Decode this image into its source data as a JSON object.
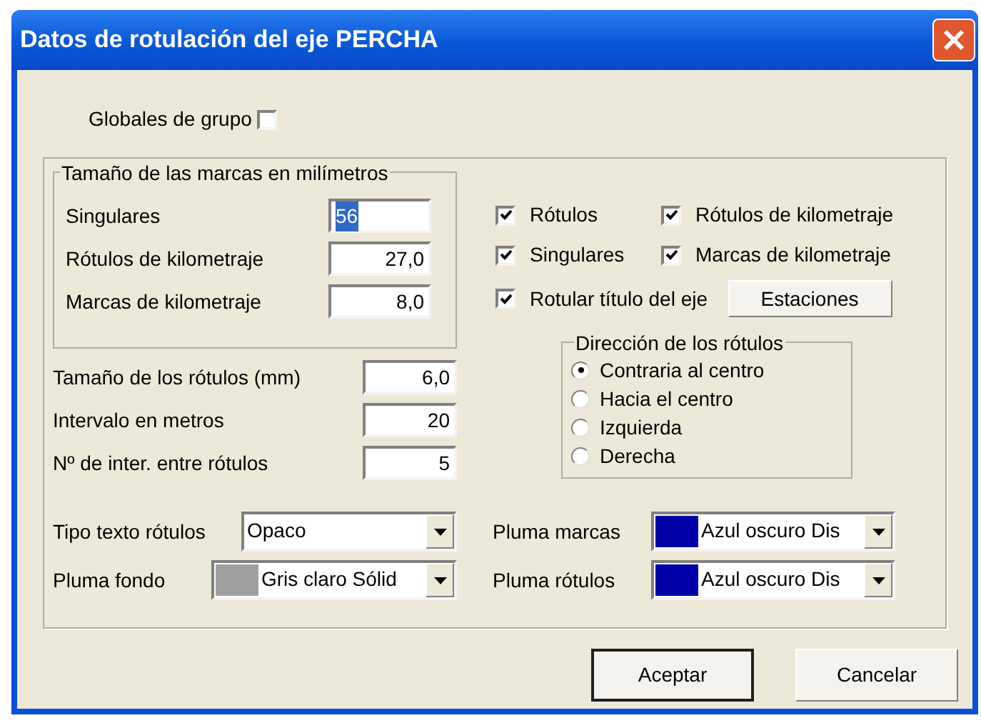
{
  "window": {
    "title": "Datos de rotulación del eje PERCHA"
  },
  "global_group": {
    "label": "Globales de grupo",
    "checked": false
  },
  "sizes_group": {
    "title": "Tamaño de las marcas en milímetros",
    "fields": [
      {
        "label": "Singulares",
        "value": "56",
        "selected": true
      },
      {
        "label": "Rótulos de kilometraje",
        "value": "27,0",
        "selected": false
      },
      {
        "label": "Marcas de kilometraje",
        "value": "8,0",
        "selected": false
      }
    ]
  },
  "fields": [
    {
      "label": "Tamaño de los rótulos (mm)",
      "value": "6,0"
    },
    {
      "label": "Intervalo en metros",
      "value": "20"
    },
    {
      "label": "Nº de inter. entre rótulos",
      "value": "5"
    }
  ],
  "checkboxes": [
    {
      "label": "Rótulos",
      "checked": true
    },
    {
      "label": "Rótulos de kilometraje",
      "checked": true
    },
    {
      "label": "Singulares",
      "checked": true
    },
    {
      "label": "Marcas de kilometraje",
      "checked": true
    },
    {
      "label": "Rotular título del eje",
      "checked": true
    }
  ],
  "stations_button": {
    "label": "Estaciones"
  },
  "direction_group": {
    "title": "Dirección de los rótulos",
    "options": [
      {
        "label": "Contraria al centro",
        "selected": true
      },
      {
        "label": "Hacia el centro",
        "selected": false
      },
      {
        "label": "Izquierda",
        "selected": false
      },
      {
        "label": "Derecha",
        "selected": false
      }
    ]
  },
  "combos": [
    {
      "label": "Tipo texto rótulos",
      "value": "Opaco"
    },
    {
      "label": "Pluma fondo",
      "value": "Gris claro Sólid",
      "color": "#a0a0a0"
    },
    {
      "label": "Pluma marcas",
      "value": "Azul oscuro Dis",
      "color": "#0000a8"
    },
    {
      "label": "Pluma rótulos",
      "value": "Azul oscuro Dis",
      "color": "#0000a8"
    }
  ],
  "buttons": [
    {
      "label": "Aceptar",
      "default": true
    },
    {
      "label": "Cancelar",
      "default": false
    }
  ]
}
